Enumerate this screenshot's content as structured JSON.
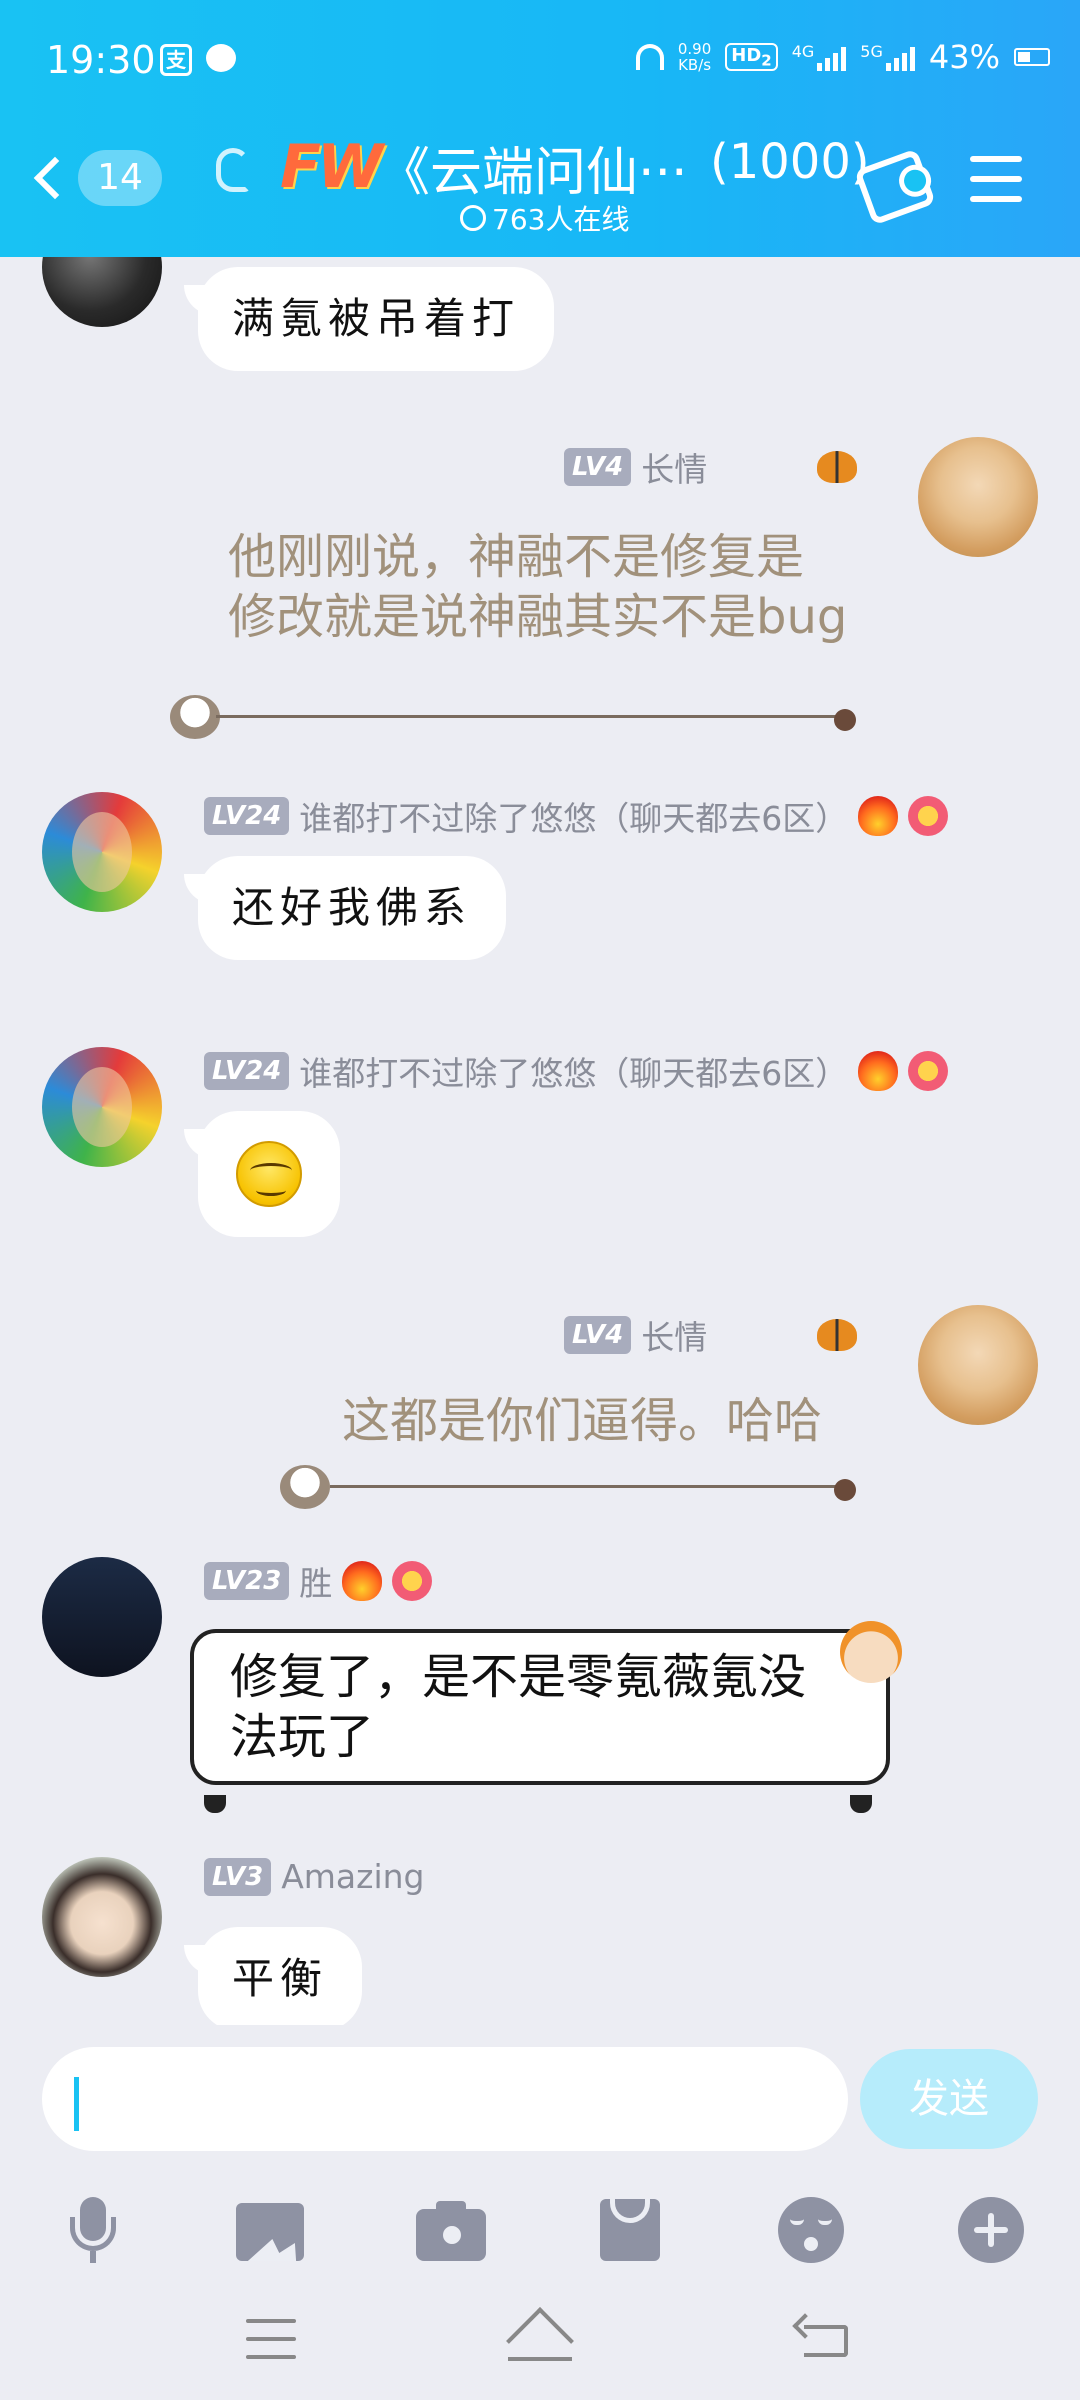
{
  "status_bar": {
    "time": "19:30",
    "net_speed_value": "0.90",
    "net_speed_unit": "KB/s",
    "hd_label": "HD",
    "hd_sub": "2",
    "sig1_label": "4G",
    "sig2_label": "5G",
    "battery": "43%",
    "icons": [
      "alipay-icon",
      "message-icon",
      "headphones-icon",
      "signal-icon",
      "battery-icon"
    ]
  },
  "nav": {
    "unread_count": "14",
    "logo_text": "FW",
    "title": "《云端问仙···",
    "member_count": "(1000)",
    "online_text": "763人在线"
  },
  "messages": [
    {
      "text": "满氪被吊着打"
    },
    {
      "level": "LV4",
      "sender": "长情",
      "text": "他刚刚说，神融不是修复是修改就是说神融其实不是bug"
    },
    {
      "level": "LV24",
      "sender": "谁都打不过除了悠悠（聊天都去6区）",
      "text": "还好我佛系"
    },
    {
      "level": "LV24",
      "sender": "谁都打不过除了悠悠（聊天都去6区）",
      "sticker": "smirk-emoji"
    },
    {
      "level": "LV4",
      "sender": "长情",
      "text": "这都是你们逼得。哈哈"
    },
    {
      "level": "LV23",
      "sender": "胜",
      "text_line1": "修复了，是不是零氪薇氪没",
      "text_line2": "法玩了"
    },
    {
      "level": "LV3",
      "sender": "Amazing",
      "text": "平衡"
    }
  ],
  "input": {
    "value": "",
    "send_label": "发送"
  },
  "toolbar": [
    "mic-icon",
    "image-icon",
    "camera-icon",
    "red-packet-icon",
    "emoji-icon",
    "plus-icon"
  ],
  "colors": {
    "header": "#19c2f3",
    "chat_bg": "#ecedf3",
    "send_btn": "#b6ecfb",
    "decorated_text": "#a1917b",
    "level_badge": "#a8acbd"
  }
}
